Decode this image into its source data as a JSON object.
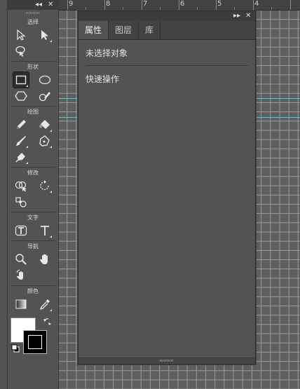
{
  "ruler": {
    "numbers": [
      "9",
      "8",
      "7",
      "6",
      "5",
      "4"
    ]
  },
  "toolbox": {
    "collapse_label": "◂◂",
    "close_label": "✕",
    "sections": {
      "select": "选择",
      "shape": "形状",
      "draw": "绘图",
      "modify": "修改",
      "text": "文字",
      "navigate": "导航",
      "color": "颜色"
    }
  },
  "panel": {
    "collapse_label": "▸▸",
    "close_label": "✕",
    "tabs": [
      {
        "label": "属性",
        "active": true
      },
      {
        "label": "图层",
        "active": false
      },
      {
        "label": "库",
        "active": false
      }
    ],
    "no_selection": "未选择对象",
    "quick_actions": "快速操作"
  },
  "colors": {
    "fill": "#ffffff",
    "stroke": "#000000",
    "guide": "#3fd0d0"
  }
}
